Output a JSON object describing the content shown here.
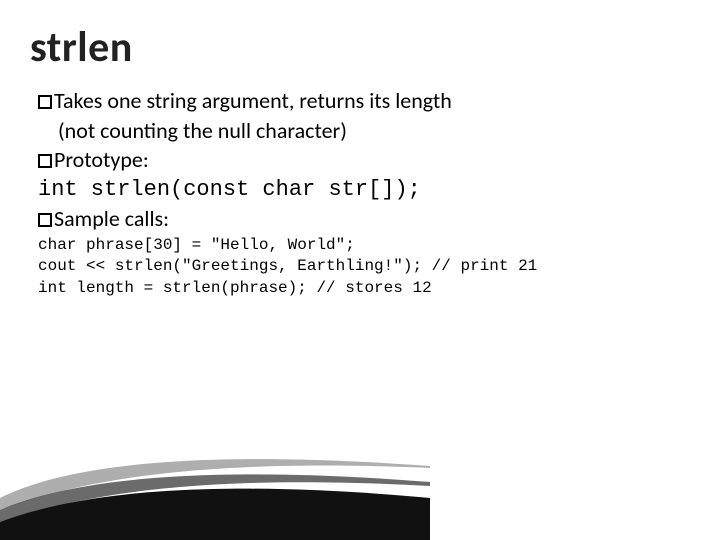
{
  "slide": {
    "title": "strlen",
    "bullet1_lead": "Takes",
    "bullet1_rest": " one string argument, returns its length",
    "bullet1_cont": "(not counting the null character)",
    "bullet2_lead": "Prototype:",
    "prototype_code": "int strlen(const char str[]);",
    "bullet3_lead": "Sample",
    "bullet3_rest": " calls:",
    "sample_code": "char phrase[30] = \"Hello, World\";\ncout << strlen(\"Greetings, Earthling!\"); // print 21\nint length = strlen(phrase); // stores 12"
  }
}
